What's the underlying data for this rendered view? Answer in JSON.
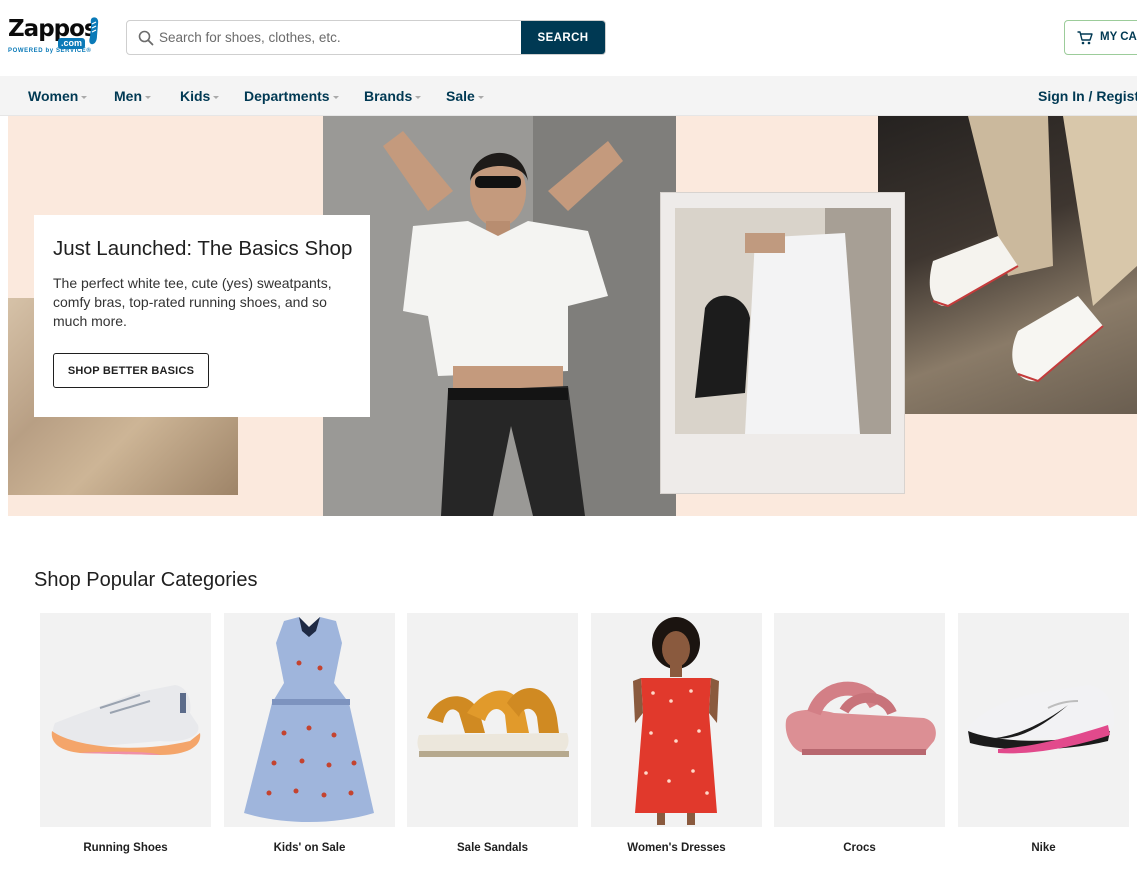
{
  "header": {
    "logo": {
      "wordmark": "Zappos",
      "domain_badge": ".com",
      "tagline": "POWERED by SERVICE®"
    },
    "search": {
      "placeholder": "Search for shoes, clothes, etc.",
      "value": "",
      "button_label": "SEARCH",
      "icon": "search-icon"
    },
    "cart": {
      "label": "MY CART",
      "icon": "cart-icon",
      "border_color": "#9ccc9a"
    }
  },
  "nav": {
    "items": [
      {
        "label": "Women"
      },
      {
        "label": "Men"
      },
      {
        "label": "Kids"
      },
      {
        "label": "Departments"
      },
      {
        "label": "Brands"
      },
      {
        "label": "Sale"
      }
    ],
    "signin_label": "Sign In / Register"
  },
  "hero": {
    "title": "Just Launched: The Basics Shop",
    "description": "The perfect white tee, cute (yes) sweatpants, comfy bras, top-rated running shoes, and so much more.",
    "cta_label": "SHOP BETTER BASICS",
    "background_color": "#fbe9dd"
  },
  "categories": {
    "heading": "Shop Popular Categories",
    "items": [
      {
        "label": "Running Shoes",
        "icon": "running-shoe-image"
      },
      {
        "label": "Kids' on Sale",
        "icon": "kids-dress-image"
      },
      {
        "label": "Sale Sandals",
        "icon": "sandal-image"
      },
      {
        "label": "Women's Dresses",
        "icon": "womens-dress-image"
      },
      {
        "label": "Crocs",
        "icon": "crocs-sandal-image"
      },
      {
        "label": "Nike",
        "icon": "nike-sneaker-image"
      }
    ]
  },
  "colors": {
    "brand_navy": "#003953",
    "brand_blue": "#0a7ab8",
    "nav_background": "#f4f4f4"
  }
}
